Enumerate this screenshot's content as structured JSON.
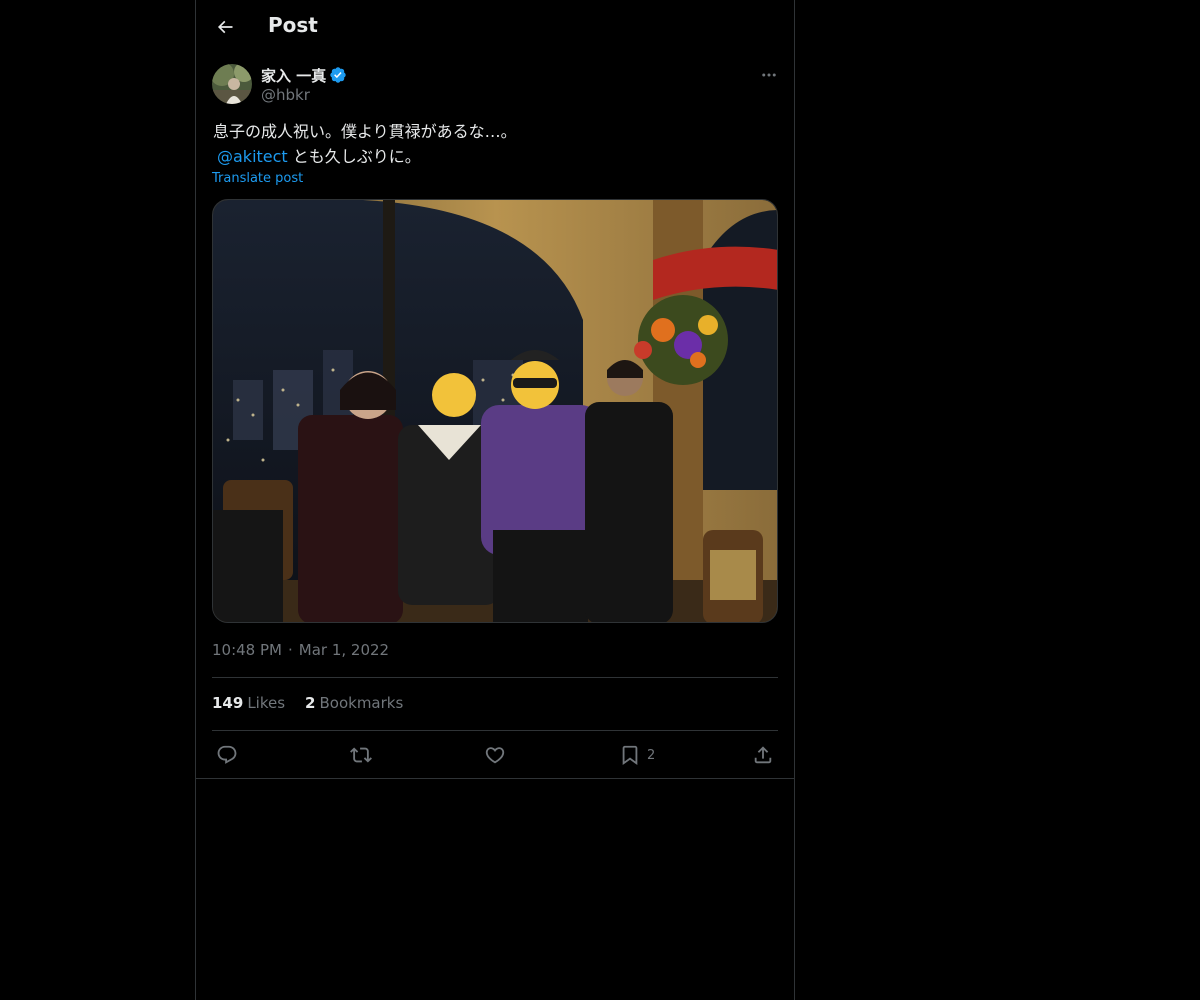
{
  "header": {
    "title": "Post",
    "back_icon": "arrow-left-icon"
  },
  "author": {
    "display_name": "家入 一真",
    "handle": "@hbkr",
    "verified_icon": "verified-badge-icon",
    "verified_color": "#1d9bf0"
  },
  "tweet": {
    "line1": "息子の成人祝い。僕より貫禄があるな…。",
    "mention": "@akitect",
    "line2_rest": " とも久しぶりに。",
    "translate_label": "Translate post"
  },
  "meta": {
    "time": "10:48 PM",
    "separator": "·",
    "date": "Mar 1, 2022"
  },
  "stats": {
    "likes_count": "149",
    "likes_label": "Likes",
    "bookmarks_count": "2",
    "bookmarks_label": "Bookmarks"
  },
  "actions": {
    "reply_icon": "reply-icon",
    "repost_icon": "repost-icon",
    "like_icon": "heart-icon",
    "bookmark_icon": "bookmark-icon",
    "bookmark_count": "2",
    "share_icon": "share-icon"
  },
  "colors": {
    "background": "#000000",
    "text": "#e7e9ea",
    "muted": "#71767b",
    "accent": "#1d9bf0",
    "border": "#2f3336"
  }
}
